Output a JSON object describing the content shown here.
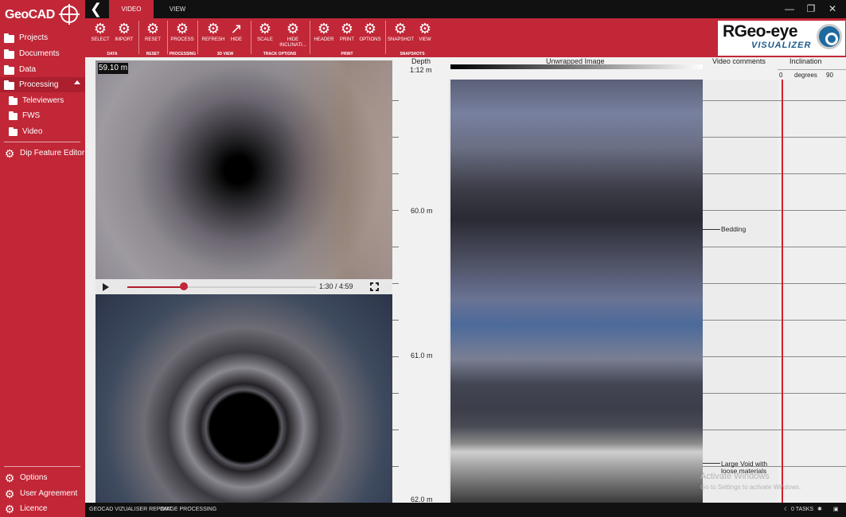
{
  "brand": {
    "name": "GeoCAD"
  },
  "sidebar": {
    "items": [
      {
        "label": "Projects"
      },
      {
        "label": "Documents"
      },
      {
        "label": "Data"
      },
      {
        "label": "Processing"
      },
      {
        "label": "Televiewers"
      },
      {
        "label": "FWS"
      },
      {
        "label": "Video"
      },
      {
        "label": "Dip Feature Editor"
      }
    ],
    "bottom": [
      {
        "label": "Options"
      },
      {
        "label": "User Agreement"
      },
      {
        "label": "Licence"
      }
    ]
  },
  "tabs": [
    {
      "label": "VIDEO"
    },
    {
      "label": "VIEW"
    }
  ],
  "ribbon": {
    "buttons": [
      {
        "label": "SELECT"
      },
      {
        "label": "IMPORT"
      },
      {
        "label": "RESET"
      },
      {
        "label": "PROCESS"
      },
      {
        "label": "REFRESH"
      },
      {
        "label": "HIDE"
      },
      {
        "label": "SCALE"
      },
      {
        "label": "HIDE INCLINATI..."
      },
      {
        "label": "HEADER"
      },
      {
        "label": "PRINT"
      },
      {
        "label": "OPTIONS"
      },
      {
        "label": "SNAPSHOT"
      },
      {
        "label": "VIEW"
      }
    ],
    "groups": [
      {
        "label": "DATA"
      },
      {
        "label": "RESET"
      },
      {
        "label": "PROCESSING"
      },
      {
        "label": "3D VIEW"
      },
      {
        "label": "TRACK OPTIONS"
      },
      {
        "label": "PRINT"
      },
      {
        "label": "SNAPSHOTS"
      }
    ]
  },
  "logo": {
    "main": "RGeo-eye",
    "sub": "VISUALIZER"
  },
  "video": {
    "depth_badge": "59.10 m",
    "time": "1:30 / 4:59",
    "progress": 0.3
  },
  "log": {
    "depth_header": "Depth",
    "depth_scale": "1:12 m",
    "unwrapped_header": "Unwrapped Image",
    "comments_header": "Video comments",
    "inclination_header": "Inclination",
    "incl_min": "0",
    "incl_unit": "degrees",
    "incl_max": "90",
    "depth_labels": [
      "60.0 m",
      "61.0 m",
      "62.0 m"
    ],
    "comments": [
      "Bedding",
      "Large Void with loose materials"
    ]
  },
  "watermark": {
    "title": "Activate Windows",
    "body": "Go to Settings to activate Windows."
  },
  "status": {
    "left1": "GEOCAD VIZUALISER REPORT",
    "left2": "IMAGE PROCESSING",
    "tasks": "0 TASKS"
  }
}
